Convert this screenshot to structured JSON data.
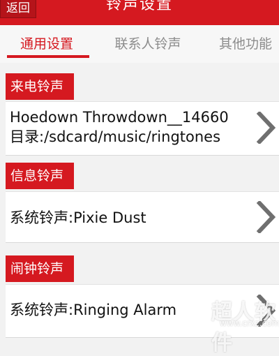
{
  "header": {
    "back_label": "返回",
    "title": "铃声设置"
  },
  "tabs": [
    {
      "label": "通用设置",
      "active": true
    },
    {
      "label": "联系人铃声",
      "active": false
    },
    {
      "label": "其他功能",
      "active": false
    }
  ],
  "sections": [
    {
      "header": "来电铃声",
      "line1": "Hoedown Throwdown__14660",
      "line2": "目录:/sdcard/music/ringtones"
    },
    {
      "header": "信息铃声",
      "line1": "系统铃声:Pixie Dust"
    },
    {
      "header": "闹钟铃声",
      "line1": "系统铃声:Ringing Alarm"
    }
  ],
  "watermark": {
    "text": "超人软件",
    "url": "www.crxz.com"
  },
  "colors": {
    "accent": "#d51920",
    "background": "#f2f2f2",
    "row_background": "#ffffff",
    "inactive_tab": "#8c8c8c"
  },
  "icons": {
    "row_arrow": "chevron-right-icon"
  }
}
